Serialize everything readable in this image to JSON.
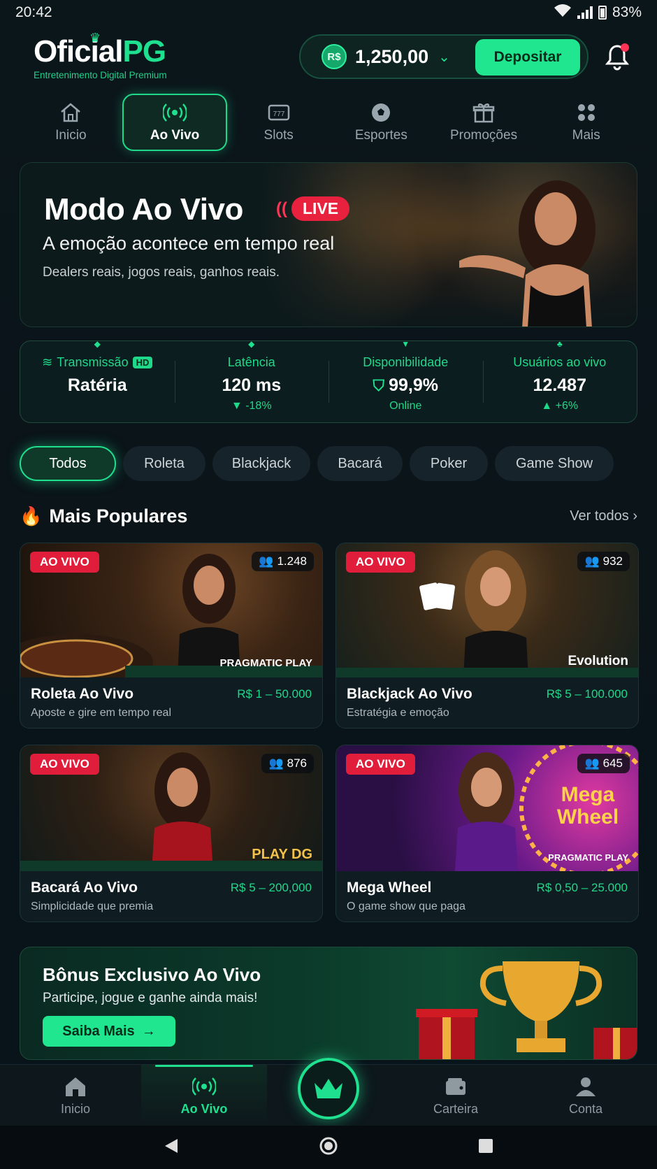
{
  "status": {
    "time": "20:42",
    "battery": "83%"
  },
  "header": {
    "brand_main": "Oficial",
    "brand_accent": "PG",
    "tagline": "Entretenimento Digital Premium",
    "currency_symbol": "R$",
    "balance": "1,250,00",
    "deposit_label": "Depositar"
  },
  "topnav": [
    {
      "label": "Inicio",
      "icon": "home-icon"
    },
    {
      "label": "Ao Vivo",
      "icon": "live-broadcast-icon",
      "active": true
    },
    {
      "label": "Slots",
      "icon": "slot-machine-icon"
    },
    {
      "label": "Esportes",
      "icon": "soccer-ball-icon"
    },
    {
      "label": "Promoções",
      "icon": "gift-icon"
    },
    {
      "label": "Mais",
      "icon": "grid-icon"
    }
  ],
  "hero": {
    "title": "Modo Ao Vivo",
    "live_badge": "LIVE",
    "subtitle": "A emoção acontece em tempo real",
    "description": "Dealers reais, jogos reais, ganhos reais."
  },
  "stats": [
    {
      "label": "Transmissão",
      "badge": "HD",
      "value": "Ratéria",
      "delta": ""
    },
    {
      "label": "Latência",
      "value": "120 ms",
      "delta": "▼ -18%"
    },
    {
      "label": "Disponibilidade",
      "value": "99,9%",
      "delta": "Online"
    },
    {
      "label": "Usuários ao vivo",
      "value": "12.487",
      "delta": "▲ +6%"
    }
  ],
  "chips": [
    "Todos",
    "Roleta",
    "Blackjack",
    "Bacará",
    "Poker",
    "Game Show"
  ],
  "section": {
    "title": "Mais Populares",
    "see_all": "Ver todos"
  },
  "games": [
    {
      "badge": "AO VIVO",
      "viewers": "1.248",
      "provider": "PRAGMATIC PLAY",
      "name": "Roleta Ao Vivo",
      "range": "R$ 1 – 50.000",
      "desc": "Aposte e gire em tempo real"
    },
    {
      "badge": "AO VIVO",
      "viewers": "932",
      "provider": "Evolution",
      "name": "Blackjack Ao Vivo",
      "range": "R$ 5 – 100.000",
      "desc": "Estratégia e emoção"
    },
    {
      "badge": "AO VIVO",
      "viewers": "876",
      "provider": "PLAY DG",
      "name": "Bacará Ao Vivo",
      "range": "R$ 5 – 200,000",
      "desc": "Simplicidade que premia"
    },
    {
      "badge": "AO VIVO",
      "viewers": "645",
      "provider": "PRAGMATIC PLAY",
      "name": "Mega Wheel",
      "range": "R$ 0,50 – 25.000",
      "desc": "O game show que paga",
      "art_text": "Mega Wheel"
    }
  ],
  "bonus": {
    "title": "Bônus Exclusivo Ao Vivo",
    "subtitle": "Participe, jogue e ganhe ainda mais!",
    "cta": "Saiba Mais"
  },
  "bottomnav": [
    {
      "label": "Inicio",
      "icon": "home-icon"
    },
    {
      "label": "Ao Vivo",
      "icon": "live-broadcast-icon",
      "active": true
    },
    {
      "label": "Carteira",
      "icon": "wallet-icon"
    },
    {
      "label": "Conta",
      "icon": "user-icon"
    }
  ],
  "colors": {
    "accent": "#1fe08f",
    "live_red": "#e01e3c",
    "background": "#0a1419"
  }
}
